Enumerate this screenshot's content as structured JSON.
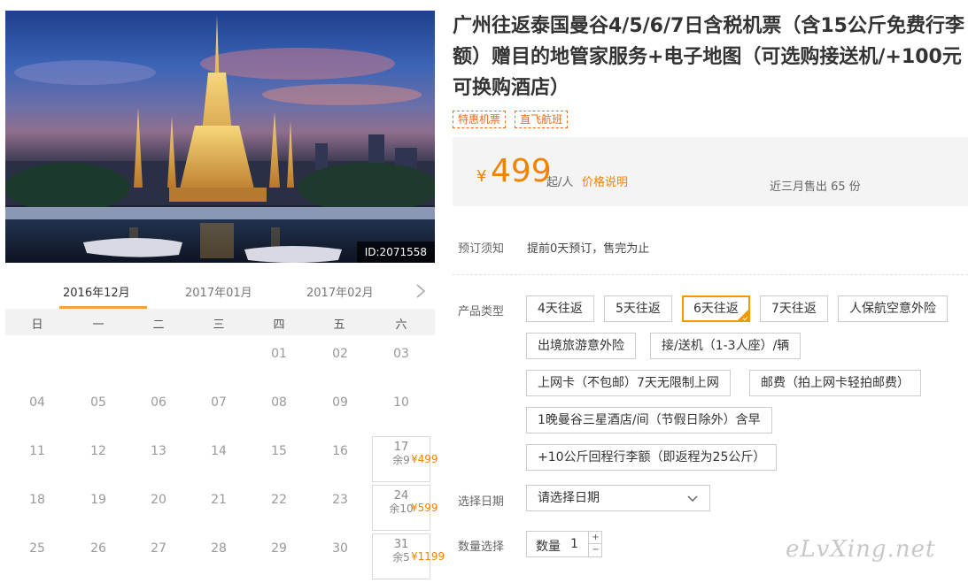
{
  "photo": {
    "id_label": "ID:2071558"
  },
  "product": {
    "title": "广州往返泰国曼谷4/5/6/7日含税机票（含15公斤免费行李额）赠目的地管家服务+电子地图（可选购接送机/+100元可换购酒店）",
    "tags": [
      "特惠机票",
      "直飞航班"
    ]
  },
  "price": {
    "currency": "¥",
    "amount": "499",
    "per": "起/人",
    "explain_link": "价格说明",
    "sold": "近三月售出 65 份"
  },
  "booking_note": {
    "label": "预订须知",
    "text": "提前0天预订，售完为止"
  },
  "product_type": {
    "label": "产品类型",
    "options": [
      "4天往返",
      "5天往返",
      "6天往返",
      "7天往返",
      "人保航空意外险",
      "出境旅游意外险",
      "接/送机（1-3人座）/辆",
      "上网卡（不包邮）7天无限制上网",
      "邮费（拍上网卡轻拍邮费）",
      "1晚曼谷三星酒店/间（节假日除外）含早",
      "+10公斤回程行李额（即返程为25公斤）"
    ],
    "selected": "6天往返"
  },
  "date_select": {
    "label": "选择日期",
    "placeholder": "请选择日期"
  },
  "quantity": {
    "label": "数量选择",
    "field_label": "数量",
    "value": "1",
    "plus": "+",
    "minus": "−"
  },
  "calendar": {
    "tabs": [
      "2016年12月",
      "2017年01月",
      "2017年02月"
    ],
    "active_tab": "2016年12月",
    "weekdays": [
      "日",
      "一",
      "二",
      "三",
      "四",
      "五",
      "六"
    ],
    "weeks": [
      [
        "",
        "",
        "",
        "",
        "01",
        "02",
        "03"
      ],
      [
        "04",
        "05",
        "06",
        "07",
        "08",
        "09",
        "10"
      ],
      [
        "11",
        "12",
        "13",
        "14",
        "15",
        "16",
        "17"
      ],
      [
        "18",
        "19",
        "20",
        "21",
        "22",
        "23",
        "24"
      ],
      [
        "25",
        "26",
        "27",
        "28",
        "29",
        "30",
        "31"
      ]
    ],
    "available": {
      "17": {
        "price": "¥499",
        "left": "余9"
      },
      "24": {
        "price": "¥599",
        "left": "余10"
      },
      "31": {
        "price": "¥1199",
        "left": "余5"
      }
    }
  },
  "watermark": "eLvXing.net",
  "colors": {
    "accent": "#f08300",
    "tag": "#ec6c1b",
    "selected_border": "#f39800"
  }
}
